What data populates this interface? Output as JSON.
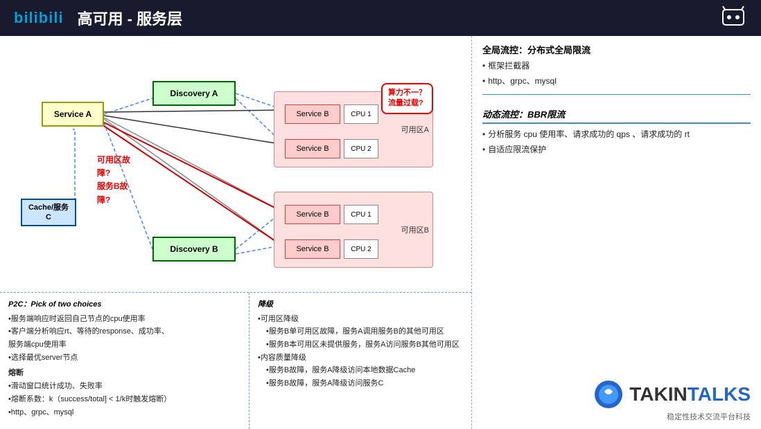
{
  "header": {
    "logo": "bilibili",
    "title": "高可用 - 服务层"
  },
  "diagram": {
    "nodes": {
      "service_a": "Service A",
      "discovery_a": "Discovery A",
      "discovery_b": "Discovery B",
      "cache": "Cache/服务\nC",
      "zone_a_label": "可用区A",
      "zone_b_label": "可用区B",
      "service_b1": "Service B",
      "service_b2": "Service B",
      "service_b3": "Service B",
      "service_b4": "Service B",
      "cpu1": "CPU 1",
      "cpu2": "CPU 2",
      "cpu3": "CPU 1",
      "cpu4": "CPU 2"
    },
    "speech_bubble": {
      "line1": "算力不一？",
      "line2": "流量过载?"
    },
    "warning": {
      "line1": "可用区故",
      "line2": "障?",
      "line3": "服务B故",
      "line4": "障?"
    }
  },
  "bottom_left": {
    "title": "P2C：Pick of two choices",
    "items": [
      "•服务端响应时返回自己节点的cpu使用率",
      "•客户端分析响应rt、等待的response、成功率、服务端cpu使用率",
      "•选择最优server节点",
      "熔断",
      "•滑动窗口统计成功、失败率",
      "•熔断系数：k（success/total] < 1/k时触发熔断）",
      "•http、grpc、mysql"
    ]
  },
  "bottom_right": {
    "title": "降级",
    "items": [
      "•可用区降级",
      "  •服务B单可用区故障，服务A调用服务B的其他可用区",
      "  •服务B本可用区未提供服务，服务A访问服务B其他可用区",
      "•内容质量降级",
      "  •服务B故障，服务A降级访问本地数据Cache",
      "  •服务B故障，服务A降级访问服务C"
    ]
  },
  "right_panel": {
    "flow_control_title": "全局流控：分布式全局限流",
    "flow_control_items": [
      "框架拦截器",
      "http、grpc、mysql"
    ],
    "dynamic_title": "动态流控：BBR限流",
    "dynamic_items": [
      "分析服务 cpu 使用率、请求成功的 qps 、请求成功的 rt",
      "自适应限流保护"
    ]
  },
  "brand": {
    "name": "TAKIN",
    "suffix": "TALKS",
    "subtitle": "稳定性技术交流平台科技"
  }
}
